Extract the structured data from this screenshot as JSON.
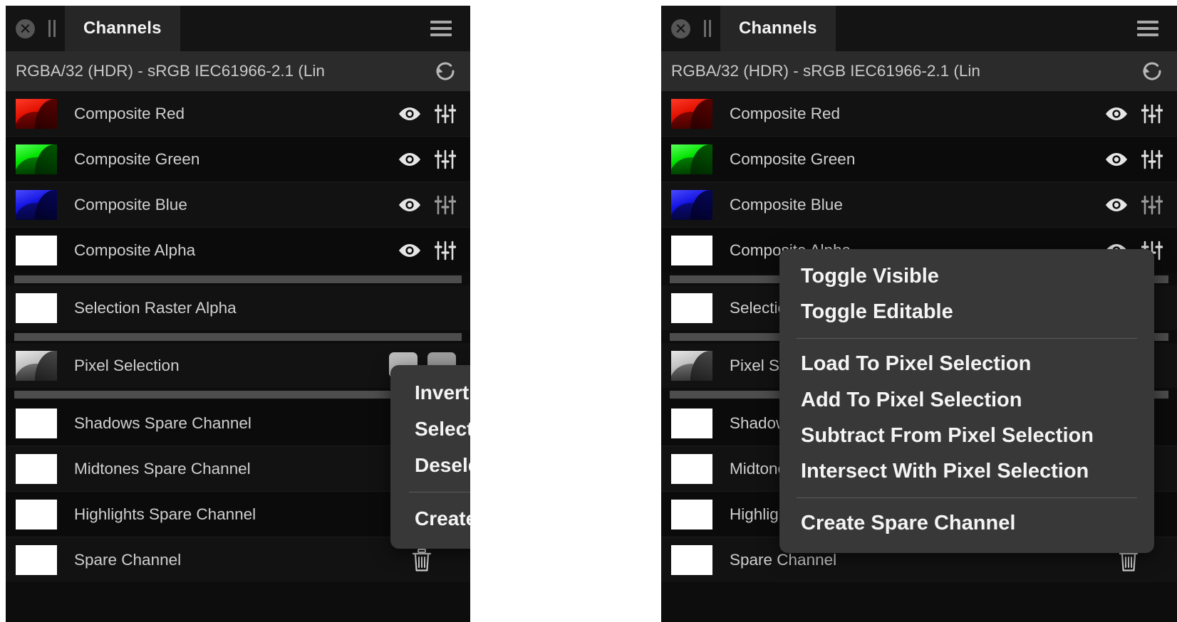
{
  "app": {
    "title": "Channels",
    "colorspace": "RGBA/32 (HDR) - sRGB IEC61966-2.1 (Lin"
  },
  "icons": {
    "close": "close-icon",
    "pause": "pause-icon",
    "menu": "hamburger-icon",
    "reset": "reset-icon",
    "visible": "eye-icon",
    "adjust": "sliders-icon",
    "delete": "trash-icon"
  },
  "panels": {
    "left": {
      "title": "Channels",
      "colorspace": "RGBA/32 (HDR) - sRGB IEC61966-2.1 (Lin"
    },
    "right": {
      "title": "Channels",
      "colorspace": "RGBA/32 (HDR) - sRGB IEC61966-2.1 (Lin"
    }
  },
  "channels": [
    {
      "label": "Composite Red",
      "thumb": "red",
      "eye": true,
      "sliders": true,
      "trash": false
    },
    {
      "label": "Composite Green",
      "thumb": "green",
      "eye": true,
      "sliders": true,
      "trash": false
    },
    {
      "label": "Composite Blue",
      "thumb": "blue",
      "eye": true,
      "sliders": true,
      "trash": false
    },
    {
      "label": "Composite Alpha",
      "thumb": "white",
      "eye": true,
      "sliders": true,
      "trash": false
    },
    {
      "label": "Selection Raster Alpha",
      "thumb": "white",
      "eye": false,
      "sliders": false,
      "trash": false
    },
    {
      "label": "Pixel Selection",
      "thumb": "gray",
      "eye": false,
      "sliders": false,
      "trash": false
    },
    {
      "label": "Shadows Spare Channel",
      "thumb": "white",
      "eye": false,
      "sliders": false,
      "trash": false
    },
    {
      "label": "Midtones Spare Channel",
      "thumb": "white",
      "eye": false,
      "sliders": false,
      "trash": false
    },
    {
      "label": "Highlights Spare Channel",
      "thumb": "white",
      "eye": false,
      "sliders": false,
      "trash": false
    },
    {
      "label": "Spare Channel",
      "thumb": "white",
      "eye": false,
      "sliders": false,
      "trash": true
    }
  ],
  "context_menu_left": {
    "items": [
      "Invert",
      "Select All",
      "Deselect"
    ],
    "footer": "Create Spare Channel"
  },
  "context_menu_right": {
    "group1": [
      "Toggle Visible",
      "Toggle Editable"
    ],
    "group2": [
      "Load To Pixel Selection",
      "Add To Pixel Selection",
      "Subtract From Pixel Selection",
      "Intersect With Pixel Selection"
    ],
    "footer": "Create Spare Channel"
  },
  "colors": {
    "panel_bg": "#0d0d0d",
    "row_bg": "#121212",
    "titlebar_bg": "#141414",
    "tab_bg": "#262626",
    "colorspace_bg": "#2b2b2b",
    "menu_bg": "#383838",
    "text": "#cfcfcf",
    "menu_text": "#f4f4f4",
    "separator": "#4d4d4d",
    "channel_red": "#e00000",
    "channel_green": "#00d200",
    "channel_blue": "#1414d2"
  }
}
